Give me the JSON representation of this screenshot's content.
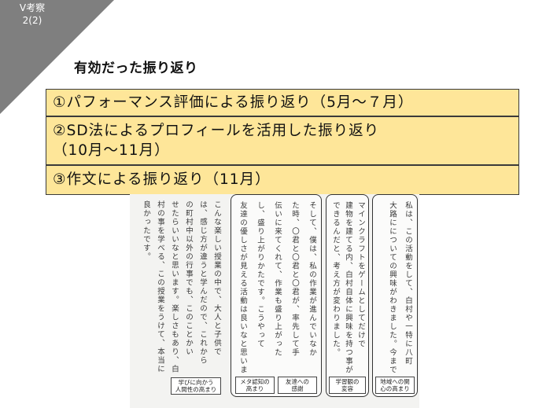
{
  "slide": {
    "section_label": "V考察\n2(2)",
    "heading": "有効だった振り返り"
  },
  "boxes": [
    "①パフォーマンス評価による振り返り（5月～７月）",
    "②SD法によるプロフィールを活用した振り返り\n（10月～11月）",
    "③作文による振り返り（11月）"
  ],
  "essay": {
    "panel1_cols": [
      "こんな楽しい授業の中で、大人と子供で",
      "は、感じ方が違うと学んだので、これから",
      "の町村中以外の行事でも、このことかい",
      "せたらいいなと思います。楽しさもあり、白",
      "村の事を学べる、この授業をうけて、本当に",
      "良かったです。"
    ],
    "panel2_cols": [
      "そして、僕は、私の作業が進んでいなか",
      "た時、〇君と〇君と〇君が、率先して手",
      "伝いに来てくれて、作業も盛り上がった",
      "し、盛り上がりかたです。こうやって",
      "友達の優しさが見える活動は良いなと思いま"
    ],
    "panel3_cols": [
      "マインクラフトをゲームとしてだけで",
      "建物を建てる内、白村自体に興味を持つ事が",
      "できるんだと、考え方が変わりました。"
    ],
    "panel4_cols": [
      "私は、この活動をして、白村や一特に八町",
      "大路にについての興味がわきました。今まで"
    ],
    "tags": {
      "t1": "学びに向かう\n人間性の高まり",
      "t2": "メタ認知の\n高まり",
      "t3": "友達への\n感謝",
      "t4": "学習観の\n変容",
      "t5": "地域への関\n心の高まり"
    }
  },
  "colors": {
    "box_fill": "#fee699",
    "corner": "#7f7f7f"
  }
}
